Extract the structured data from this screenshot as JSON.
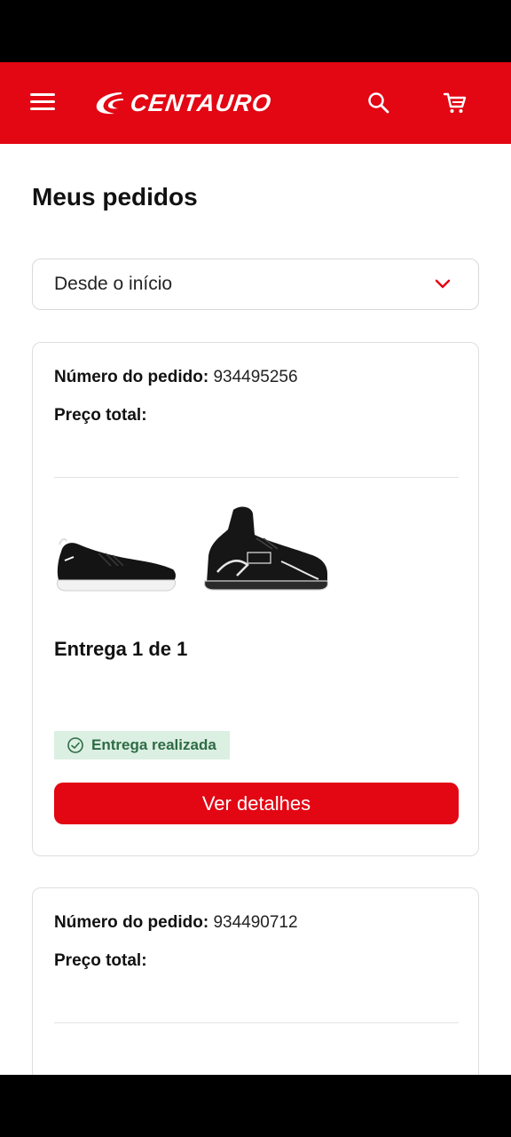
{
  "header": {
    "brand": "CENTAURO",
    "colors": {
      "primary": "#e30613",
      "success_bg": "#dbefe2",
      "success_text": "#2e6b45"
    },
    "icons": [
      "menu-icon",
      "search-icon",
      "cart-icon"
    ]
  },
  "page": {
    "title": "Meus pedidos"
  },
  "filter": {
    "selected": "Desde o início",
    "icon": "chevron-down-icon"
  },
  "orders": [
    {
      "number_label": "Número do pedido:",
      "number": "934495256",
      "total_label": "Preço total:",
      "total": "",
      "products": [
        "black-running-sneaker",
        "black-high-top-everlast-shoe"
      ],
      "delivery": "Entrega 1 de 1",
      "status": "Entrega realizada",
      "button": "Ver detalhes"
    },
    {
      "number_label": "Número do pedido:",
      "number": "934490712",
      "total_label": "Preço total:",
      "total": ""
    }
  ]
}
